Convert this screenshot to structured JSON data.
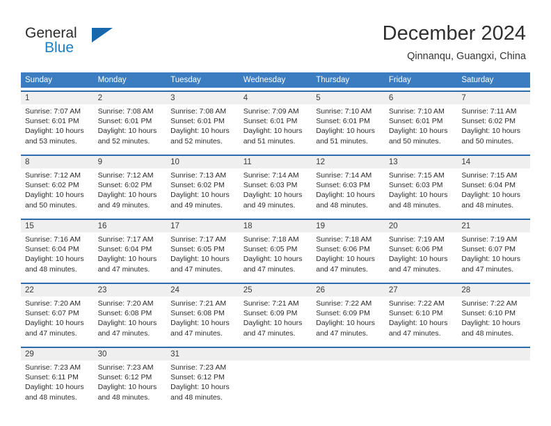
{
  "brand": {
    "word_one": "General",
    "word_two": "Blue",
    "triangle_icon": "triangle-icon"
  },
  "header": {
    "title": "December 2024",
    "subtitle": "Qinnanqu, Guangxi, China"
  },
  "theme": {
    "header_blue": "#3b7dc0",
    "row_border_blue": "#2c6cad",
    "day_number_band": "#efefef",
    "logo_blue": "#1a7fc1",
    "text": "#2b2b2b"
  },
  "weekdays": [
    "Sunday",
    "Monday",
    "Tuesday",
    "Wednesday",
    "Thursday",
    "Friday",
    "Saturday"
  ],
  "weeks": [
    [
      {
        "day": "1",
        "sunrise": "Sunrise: 7:07 AM",
        "sunset": "Sunset: 6:01 PM",
        "daylight1": "Daylight: 10 hours",
        "daylight2": "and 53 minutes."
      },
      {
        "day": "2",
        "sunrise": "Sunrise: 7:08 AM",
        "sunset": "Sunset: 6:01 PM",
        "daylight1": "Daylight: 10 hours",
        "daylight2": "and 52 minutes."
      },
      {
        "day": "3",
        "sunrise": "Sunrise: 7:08 AM",
        "sunset": "Sunset: 6:01 PM",
        "daylight1": "Daylight: 10 hours",
        "daylight2": "and 52 minutes."
      },
      {
        "day": "4",
        "sunrise": "Sunrise: 7:09 AM",
        "sunset": "Sunset: 6:01 PM",
        "daylight1": "Daylight: 10 hours",
        "daylight2": "and 51 minutes."
      },
      {
        "day": "5",
        "sunrise": "Sunrise: 7:10 AM",
        "sunset": "Sunset: 6:01 PM",
        "daylight1": "Daylight: 10 hours",
        "daylight2": "and 51 minutes."
      },
      {
        "day": "6",
        "sunrise": "Sunrise: 7:10 AM",
        "sunset": "Sunset: 6:01 PM",
        "daylight1": "Daylight: 10 hours",
        "daylight2": "and 50 minutes."
      },
      {
        "day": "7",
        "sunrise": "Sunrise: 7:11 AM",
        "sunset": "Sunset: 6:02 PM",
        "daylight1": "Daylight: 10 hours",
        "daylight2": "and 50 minutes."
      }
    ],
    [
      {
        "day": "8",
        "sunrise": "Sunrise: 7:12 AM",
        "sunset": "Sunset: 6:02 PM",
        "daylight1": "Daylight: 10 hours",
        "daylight2": "and 50 minutes."
      },
      {
        "day": "9",
        "sunrise": "Sunrise: 7:12 AM",
        "sunset": "Sunset: 6:02 PM",
        "daylight1": "Daylight: 10 hours",
        "daylight2": "and 49 minutes."
      },
      {
        "day": "10",
        "sunrise": "Sunrise: 7:13 AM",
        "sunset": "Sunset: 6:02 PM",
        "daylight1": "Daylight: 10 hours",
        "daylight2": "and 49 minutes."
      },
      {
        "day": "11",
        "sunrise": "Sunrise: 7:14 AM",
        "sunset": "Sunset: 6:03 PM",
        "daylight1": "Daylight: 10 hours",
        "daylight2": "and 49 minutes."
      },
      {
        "day": "12",
        "sunrise": "Sunrise: 7:14 AM",
        "sunset": "Sunset: 6:03 PM",
        "daylight1": "Daylight: 10 hours",
        "daylight2": "and 48 minutes."
      },
      {
        "day": "13",
        "sunrise": "Sunrise: 7:15 AM",
        "sunset": "Sunset: 6:03 PM",
        "daylight1": "Daylight: 10 hours",
        "daylight2": "and 48 minutes."
      },
      {
        "day": "14",
        "sunrise": "Sunrise: 7:15 AM",
        "sunset": "Sunset: 6:04 PM",
        "daylight1": "Daylight: 10 hours",
        "daylight2": "and 48 minutes."
      }
    ],
    [
      {
        "day": "15",
        "sunrise": "Sunrise: 7:16 AM",
        "sunset": "Sunset: 6:04 PM",
        "daylight1": "Daylight: 10 hours",
        "daylight2": "and 48 minutes."
      },
      {
        "day": "16",
        "sunrise": "Sunrise: 7:17 AM",
        "sunset": "Sunset: 6:04 PM",
        "daylight1": "Daylight: 10 hours",
        "daylight2": "and 47 minutes."
      },
      {
        "day": "17",
        "sunrise": "Sunrise: 7:17 AM",
        "sunset": "Sunset: 6:05 PM",
        "daylight1": "Daylight: 10 hours",
        "daylight2": "and 47 minutes."
      },
      {
        "day": "18",
        "sunrise": "Sunrise: 7:18 AM",
        "sunset": "Sunset: 6:05 PM",
        "daylight1": "Daylight: 10 hours",
        "daylight2": "and 47 minutes."
      },
      {
        "day": "19",
        "sunrise": "Sunrise: 7:18 AM",
        "sunset": "Sunset: 6:06 PM",
        "daylight1": "Daylight: 10 hours",
        "daylight2": "and 47 minutes."
      },
      {
        "day": "20",
        "sunrise": "Sunrise: 7:19 AM",
        "sunset": "Sunset: 6:06 PM",
        "daylight1": "Daylight: 10 hours",
        "daylight2": "and 47 minutes."
      },
      {
        "day": "21",
        "sunrise": "Sunrise: 7:19 AM",
        "sunset": "Sunset: 6:07 PM",
        "daylight1": "Daylight: 10 hours",
        "daylight2": "and 47 minutes."
      }
    ],
    [
      {
        "day": "22",
        "sunrise": "Sunrise: 7:20 AM",
        "sunset": "Sunset: 6:07 PM",
        "daylight1": "Daylight: 10 hours",
        "daylight2": "and 47 minutes."
      },
      {
        "day": "23",
        "sunrise": "Sunrise: 7:20 AM",
        "sunset": "Sunset: 6:08 PM",
        "daylight1": "Daylight: 10 hours",
        "daylight2": "and 47 minutes."
      },
      {
        "day": "24",
        "sunrise": "Sunrise: 7:21 AM",
        "sunset": "Sunset: 6:08 PM",
        "daylight1": "Daylight: 10 hours",
        "daylight2": "and 47 minutes."
      },
      {
        "day": "25",
        "sunrise": "Sunrise: 7:21 AM",
        "sunset": "Sunset: 6:09 PM",
        "daylight1": "Daylight: 10 hours",
        "daylight2": "and 47 minutes."
      },
      {
        "day": "26",
        "sunrise": "Sunrise: 7:22 AM",
        "sunset": "Sunset: 6:09 PM",
        "daylight1": "Daylight: 10 hours",
        "daylight2": "and 47 minutes."
      },
      {
        "day": "27",
        "sunrise": "Sunrise: 7:22 AM",
        "sunset": "Sunset: 6:10 PM",
        "daylight1": "Daylight: 10 hours",
        "daylight2": "and 47 minutes."
      },
      {
        "day": "28",
        "sunrise": "Sunrise: 7:22 AM",
        "sunset": "Sunset: 6:10 PM",
        "daylight1": "Daylight: 10 hours",
        "daylight2": "and 48 minutes."
      }
    ],
    [
      {
        "day": "29",
        "sunrise": "Sunrise: 7:23 AM",
        "sunset": "Sunset: 6:11 PM",
        "daylight1": "Daylight: 10 hours",
        "daylight2": "and 48 minutes."
      },
      {
        "day": "30",
        "sunrise": "Sunrise: 7:23 AM",
        "sunset": "Sunset: 6:12 PM",
        "daylight1": "Daylight: 10 hours",
        "daylight2": "and 48 minutes."
      },
      {
        "day": "31",
        "sunrise": "Sunrise: 7:23 AM",
        "sunset": "Sunset: 6:12 PM",
        "daylight1": "Daylight: 10 hours",
        "daylight2": "and 48 minutes."
      },
      {
        "day": "",
        "sunrise": "",
        "sunset": "",
        "daylight1": "",
        "daylight2": ""
      },
      {
        "day": "",
        "sunrise": "",
        "sunset": "",
        "daylight1": "",
        "daylight2": ""
      },
      {
        "day": "",
        "sunrise": "",
        "sunset": "",
        "daylight1": "",
        "daylight2": ""
      },
      {
        "day": "",
        "sunrise": "",
        "sunset": "",
        "daylight1": "",
        "daylight2": ""
      }
    ]
  ]
}
